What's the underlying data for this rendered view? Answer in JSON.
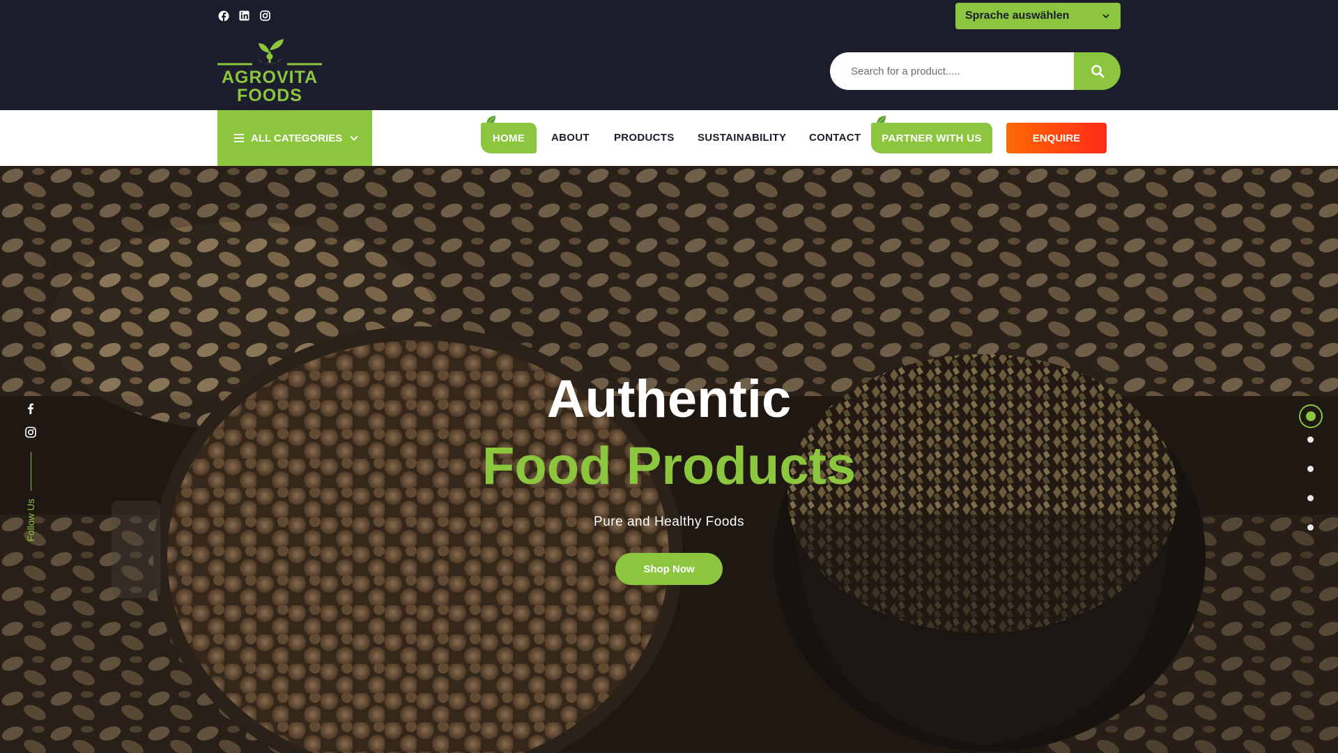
{
  "topbar": {
    "social": [
      "facebook-icon",
      "linkedin-icon",
      "instagram-icon"
    ],
    "language_select": "Sprache auswählen"
  },
  "header": {
    "logo": {
      "line1": "AGROVITA",
      "line2": "FOODS"
    },
    "search": {
      "placeholder": "Search for a product.....",
      "value": ""
    }
  },
  "nav": {
    "categories_label": "ALL CATEGORIES",
    "items": [
      "HOME",
      "ABOUT",
      "PRODUCTS",
      "SUSTAINABILITY",
      "CONTACT",
      "PARTNER WITH US"
    ],
    "active": "HOME",
    "enquire_label": "ENQUIRE"
  },
  "hero": {
    "title_line1": "Authentic",
    "title_line2": "Food Products",
    "subtitle": "Pure and Healthy Foods",
    "cta_label": "Shop Now",
    "follow_label": "Follow Us",
    "slides_total": 5,
    "slide_active": 1
  },
  "colors": {
    "brand_green": "#8cc63f",
    "dark": "#1b1d2c",
    "enquire_start": "#ff6a00",
    "enquire_end": "#ff2a1a"
  }
}
